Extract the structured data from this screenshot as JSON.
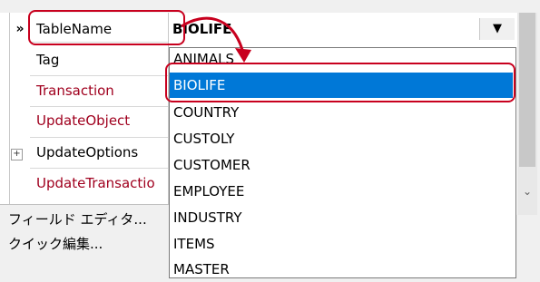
{
  "property_grid": {
    "rows": [
      {
        "label": "TableName",
        "style": "black"
      },
      {
        "label": "Tag",
        "style": "black"
      },
      {
        "label": "Transaction",
        "style": "red"
      },
      {
        "label": "UpdateObject",
        "style": "red"
      },
      {
        "label": "UpdateOptions",
        "style": "black"
      },
      {
        "label": "UpdateTransactio",
        "style": "red"
      }
    ],
    "active_indicator": "»",
    "expand_glyph": "+",
    "current_value": "BIOLIFE",
    "dropdown_glyph": "▼",
    "scroll_down_glyph": "⌄"
  },
  "dropdown_list": {
    "items": [
      "ANIMALS",
      "BIOLIFE",
      "COUNTRY",
      "CUSTOLY",
      "CUSTOMER",
      "EMPLOYEE",
      "INDUSTRY",
      "ITEMS",
      "MASTER"
    ],
    "selected": "BIOLIFE"
  },
  "links": {
    "field_editor": "フィールド エディタ...",
    "quick_edit": "クイック編集..."
  },
  "colors": {
    "selection": "#0078d7",
    "callout": "#c8001e",
    "required_property": "#a0001e"
  },
  "icons": {
    "row_indicator": "double-chevron-right-icon",
    "expand": "plus-box-icon",
    "dropdown": "triangle-down-icon",
    "scroll_down": "chevron-down-icon"
  }
}
